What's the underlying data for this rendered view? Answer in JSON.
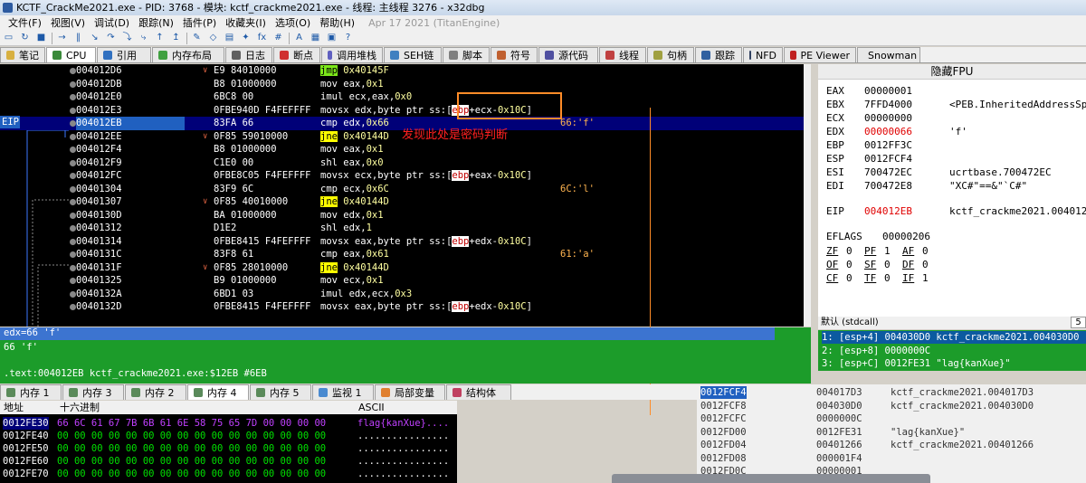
{
  "window": {
    "title": "KCTF_CrackMe2021.exe - PID: 3768 - 模块: kctf_crackme2021.exe - 线程: 主线程 3276 - x32dbg"
  },
  "menu": {
    "items": [
      "文件(F)",
      "视图(V)",
      "调试(D)",
      "跟踪(N)",
      "插件(P)",
      "收藏夹(I)",
      "选项(O)",
      "帮助(H)"
    ],
    "date": "Apr 17 2021 (TitanEngine)"
  },
  "toolbar": {
    "icons": [
      "open-icon",
      "restart-icon",
      "close-icon",
      "run-icon",
      "pause-icon",
      "step-into-icon",
      "step-over-icon",
      "trace-into-icon",
      "trace-over-icon",
      "execute-till-return-icon",
      "run-to-user-code-icon",
      "patch-icon",
      "comment-icon",
      "label-icon",
      "bookmark-icon",
      "function-icon",
      "hash-icon",
      "script-icon",
      "calculator-icon",
      "options-icon",
      "help-icon"
    ],
    "glyphs": [
      "▭",
      "↻",
      "■",
      "→",
      "‖",
      "↘",
      "↷",
      "⤵",
      "⤷",
      "↑",
      "↥",
      "✎",
      "◇",
      "▤",
      "✦",
      "fx",
      "#",
      "A",
      "▦",
      "▣",
      "?"
    ]
  },
  "tabs": [
    {
      "label": "笔记",
      "icon": "notes-icon",
      "color": "#d8b040"
    },
    {
      "label": "CPU",
      "icon": "cpu-icon",
      "color": "#3a8a3a"
    },
    {
      "label": "引用",
      "icon": "references-icon",
      "color": "#3070c0"
    },
    {
      "label": "内存布局",
      "icon": "memory-map-icon",
      "color": "#40a040"
    },
    {
      "label": "日志",
      "icon": "log-icon",
      "color": "#606060"
    },
    {
      "label": "断点",
      "icon": "breakpoints-icon",
      "color": "#d03030"
    },
    {
      "label": "调用堆栈",
      "icon": "call-stack-icon",
      "color": "#6060c0"
    },
    {
      "label": "SEH链",
      "icon": "seh-icon",
      "color": "#4080c0"
    },
    {
      "label": "脚本",
      "icon": "script-icon",
      "color": "#808080"
    },
    {
      "label": "符号",
      "icon": "symbols-icon",
      "color": "#c06030"
    },
    {
      "label": "源代码",
      "icon": "source-icon",
      "color": "#5050a0"
    },
    {
      "label": "线程",
      "icon": "threads-icon",
      "color": "#c04040"
    },
    {
      "label": "句柄",
      "icon": "handles-icon",
      "color": "#a0a040"
    },
    {
      "label": "跟踪",
      "icon": "trace-icon",
      "color": "#3060a0"
    },
    {
      "label": "NFD",
      "icon": "nfd-icon",
      "color": "#304060"
    },
    {
      "label": "PE Viewer",
      "icon": "pe-icon",
      "color": "#c02020"
    },
    {
      "label": "Snowman",
      "icon": "snowman-icon",
      "color": "#7090b0"
    }
  ],
  "disasm": {
    "eip_label": "EIP",
    "annotation": "发现此处是密码判断",
    "rows": [
      {
        "addr": "004012D6",
        "arrow": "∨",
        "bytes": "E9 84010000",
        "ins": [
          [
            "jmp",
            "jmp"
          ],
          [
            " ",
            ""
          ],
          [
            "0x40145F",
            "imm"
          ]
        ],
        "cmt": ""
      },
      {
        "addr": "004012DB",
        "arrow": "",
        "bytes": "B8 01000000",
        "ins": [
          [
            "mov eax,",
            ""
          ],
          [
            "0x1",
            "imm"
          ]
        ],
        "cmt": ""
      },
      {
        "addr": "004012E0",
        "arrow": "",
        "bytes": "6BC8 00",
        "ins": [
          [
            "imul ecx,eax,",
            ""
          ],
          [
            "0x0",
            "imm"
          ]
        ],
        "cmt": ""
      },
      {
        "addr": "004012E3",
        "arrow": "",
        "bytes": "0FBE940D F4FEFFFF",
        "ins": [
          [
            "movsx edx,byte ptr ss:[",
            ""
          ],
          [
            "ebp",
            "ebp"
          ],
          [
            "+ecx-",
            ""
          ],
          [
            "0x10C",
            "neg"
          ],
          [
            "]",
            ""
          ]
        ],
        "cmt": ""
      },
      {
        "addr": "004012EB",
        "arrow": "",
        "bytes": "83FA 66",
        "ins": [
          [
            "cmp edx,",
            ""
          ],
          [
            "0x66",
            "imm"
          ]
        ],
        "cmt": "66:'f'",
        "sel": true
      },
      {
        "addr": "004012EE",
        "arrow": "∨",
        "bytes": "0F85 59010000",
        "ins": [
          [
            "jne",
            "jne"
          ],
          [
            " ",
            ""
          ],
          [
            "0x40144D",
            "imm"
          ]
        ],
        "cmt": ""
      },
      {
        "addr": "004012F4",
        "arrow": "",
        "bytes": "B8 01000000",
        "ins": [
          [
            "mov eax,",
            ""
          ],
          [
            "0x1",
            "imm"
          ]
        ],
        "cmt": ""
      },
      {
        "addr": "004012F9",
        "arrow": "",
        "bytes": "C1E0 00",
        "ins": [
          [
            "shl eax,",
            ""
          ],
          [
            "0x0",
            "imm"
          ]
        ],
        "cmt": ""
      },
      {
        "addr": "004012FC",
        "arrow": "",
        "bytes": "0FBE8C05 F4FEFFFF",
        "ins": [
          [
            "movsx ecx,byte ptr ss:[",
            ""
          ],
          [
            "ebp",
            "ebp"
          ],
          [
            "+eax-",
            ""
          ],
          [
            "0x10C",
            "neg"
          ],
          [
            "]",
            ""
          ]
        ],
        "cmt": ""
      },
      {
        "addr": "00401304",
        "arrow": "",
        "bytes": "83F9 6C",
        "ins": [
          [
            "cmp ecx,",
            ""
          ],
          [
            "0x6C",
            "imm"
          ]
        ],
        "cmt": "6C:'l'"
      },
      {
        "addr": "00401307",
        "arrow": "∨",
        "bytes": "0F85 40010000",
        "ins": [
          [
            "jne",
            "jne"
          ],
          [
            " ",
            ""
          ],
          [
            "0x40144D",
            "imm"
          ]
        ],
        "cmt": ""
      },
      {
        "addr": "0040130D",
        "arrow": "",
        "bytes": "BA 01000000",
        "ins": [
          [
            "mov edx,",
            ""
          ],
          [
            "0x1",
            "imm"
          ]
        ],
        "cmt": ""
      },
      {
        "addr": "00401312",
        "arrow": "",
        "bytes": "D1E2",
        "ins": [
          [
            "shl edx,",
            ""
          ],
          [
            "1",
            "imm"
          ]
        ],
        "cmt": ""
      },
      {
        "addr": "00401314",
        "arrow": "",
        "bytes": "0FBE8415 F4FEFFFF",
        "ins": [
          [
            "movsx eax,byte ptr ss:[",
            ""
          ],
          [
            "ebp",
            "ebp"
          ],
          [
            "+edx-",
            ""
          ],
          [
            "0x10C",
            "neg"
          ],
          [
            "]",
            ""
          ]
        ],
        "cmt": ""
      },
      {
        "addr": "0040131C",
        "arrow": "",
        "bytes": "83F8 61",
        "ins": [
          [
            "cmp eax,",
            ""
          ],
          [
            "0x61",
            "imm"
          ]
        ],
        "cmt": "61:'a'"
      },
      {
        "addr": "0040131F",
        "arrow": "∨",
        "bytes": "0F85 28010000",
        "ins": [
          [
            "jne",
            "jne"
          ],
          [
            " ",
            ""
          ],
          [
            "0x40144D",
            "imm"
          ]
        ],
        "cmt": ""
      },
      {
        "addr": "00401325",
        "arrow": "",
        "bytes": "B9 01000000",
        "ins": [
          [
            "mov ecx,",
            ""
          ],
          [
            "0x1",
            "imm"
          ]
        ],
        "cmt": ""
      },
      {
        "addr": "0040132A",
        "arrow": "",
        "bytes": "6BD1 03",
        "ins": [
          [
            "imul edx,ecx,",
            ""
          ],
          [
            "0x3",
            "imm"
          ]
        ],
        "cmt": ""
      },
      {
        "addr": "0040132D",
        "arrow": "",
        "bytes": "0FBE8415 F4FEFFFF",
        "ins": [
          [
            "movsx eax,byte ptr ss:[",
            ""
          ],
          [
            "ebp",
            "ebp"
          ],
          [
            "+edx-",
            ""
          ],
          [
            "0x10C",
            "neg"
          ],
          [
            "]",
            ""
          ]
        ],
        "cmt": ""
      }
    ]
  },
  "info": {
    "line1": "edx=66 'f'",
    "line2": "66 'f'",
    "line3": ".text:004012EB kctf_crackme2021.exe:$12EB #6EB"
  },
  "memtabs": [
    {
      "label": "内存 1",
      "icon": "memory-icon"
    },
    {
      "label": "内存 3",
      "icon": "memory-icon"
    },
    {
      "label": "内存 2",
      "icon": "memory-icon"
    },
    {
      "label": "内存 4",
      "icon": "memory-icon"
    },
    {
      "label": "内存 5",
      "icon": "memory-icon"
    },
    {
      "label": "监视 1",
      "icon": "watch-icon"
    },
    {
      "label": "局部变量",
      "icon": "locals-icon"
    },
    {
      "label": "结构体",
      "icon": "struct-icon"
    }
  ],
  "dump": {
    "headers": {
      "addr": "地址",
      "hex": "十六进制",
      "ascii": "ASCII"
    },
    "rows": [
      {
        "addr": "0012FE30",
        "hex": "66 6C 61 67 7B 6B 61 6E 58 75 65 7D 00 00 00 00",
        "ascii": "flag{kanXue}....",
        "sel": true
      },
      {
        "addr": "0012FE40",
        "hex": "00 00 00 00 00 00 00 00 00 00 00 00 00 00 00 00",
        "ascii": "................"
      },
      {
        "addr": "0012FE50",
        "hex": "00 00 00 00 00 00 00 00 00 00 00 00 00 00 00 00",
        "ascii": "................"
      },
      {
        "addr": "0012FE60",
        "hex": "00 00 00 00 00 00 00 00 00 00 00 00 00 00 00 00",
        "ascii": "................"
      },
      {
        "addr": "0012FE70",
        "hex": "00 00 00 00 00 00 00 00 00 00 00 00 00 00 00 00",
        "ascii": "................"
      }
    ]
  },
  "stack": {
    "rows": [
      {
        "addr": "0012FCF4",
        "val": "004017D3",
        "cmt": "kctf_crackme2021.004017D3",
        "sel": true
      },
      {
        "addr": "0012FCF8",
        "val": "004030D0",
        "cmt": "kctf_crackme2021.004030D0"
      },
      {
        "addr": "0012FCFC",
        "val": "0000000C",
        "cmt": ""
      },
      {
        "addr": "0012FD00",
        "val": "0012FE31",
        "cmt": "\"lag{kanXue}\""
      },
      {
        "addr": "0012FD04",
        "val": "00401266",
        "cmt": "kctf_crackme2021.00401266"
      },
      {
        "addr": "0012FD08",
        "val": "000001F4",
        "cmt": ""
      },
      {
        "addr": "0012FD0C",
        "val": "00000001",
        "cmt": ""
      }
    ]
  },
  "registers": {
    "title": "隐藏FPU",
    "rows": [
      {
        "n": "EAX",
        "v": "00000001",
        "d": ""
      },
      {
        "n": "EBX",
        "v": "7FFD4000",
        "d": "<PEB.InheritedAddressSpace>"
      },
      {
        "n": "ECX",
        "v": "00000000",
        "d": ""
      },
      {
        "n": "EDX",
        "v": "00000066",
        "d": "'f'",
        "red": true
      },
      {
        "n": "EBP",
        "v": "0012FF3C",
        "d": ""
      },
      {
        "n": "ESP",
        "v": "0012FCF4",
        "d": ""
      },
      {
        "n": "ESI",
        "v": "700472EC",
        "d": "ucrtbase.700472EC"
      },
      {
        "n": "EDI",
        "v": "700472E8",
        "d": "\"XC#\"==&\"`C#\""
      },
      {
        "n": "EIP",
        "v": "004012EB",
        "d": "kctf_crackme2021.004012EB",
        "red": true,
        "gap": true
      }
    ],
    "eflags_label": "EFLAGS",
    "eflags": "00000206",
    "flags": [
      [
        "ZF",
        "0"
      ],
      [
        "PF",
        "1"
      ],
      [
        "AF",
        "0"
      ],
      [
        "OF",
        "0"
      ],
      [
        "SF",
        "0"
      ],
      [
        "DF",
        "0"
      ],
      [
        "CF",
        "0"
      ],
      [
        "TF",
        "0"
      ],
      [
        "IF",
        "1"
      ]
    ]
  },
  "callconv": {
    "label": "默认 (stdcall)",
    "count": "5"
  },
  "callargs": [
    {
      "text": "1: [esp+4] 004030D0 kctf_crackme2021.004030D0",
      "sel": true
    },
    {
      "text": "2: [esp+8] 0000000C"
    },
    {
      "text": "3: [esp+C] 0012FE31 \"lag{kanXue}\""
    }
  ]
}
